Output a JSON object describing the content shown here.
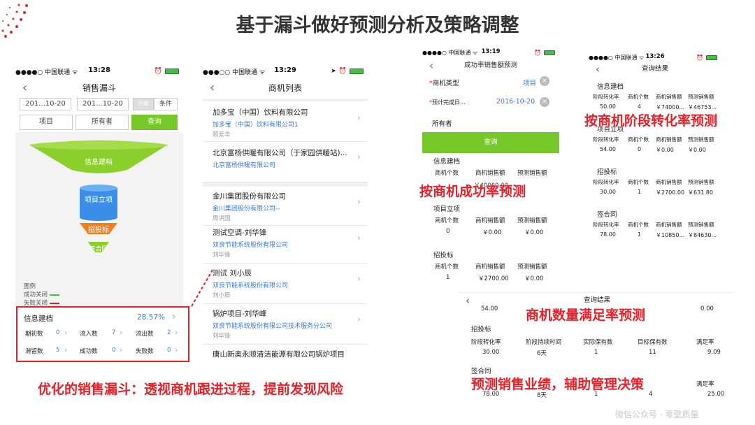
{
  "title": "基于漏斗做好预测分析及策略调整",
  "phone1": {
    "carrier": "●●●●○ 中国联通 ᯤ",
    "time": "13:28",
    "nav_title": "销售漏斗",
    "date_from": "201...10-20",
    "date_to": "201...10-20",
    "seg_plan": "方案",
    "seg_cond": "条件",
    "btn_project": "项目",
    "btn_owner": "所有者",
    "btn_query": "查询",
    "funnel": [
      "信息建档",
      "项目立项",
      "招投标",
      "签合同"
    ],
    "legend_title": "图例",
    "legend_won": "成功关闭",
    "legend_lost": "失败关闭",
    "summary_label": "信息建档",
    "summary_value": "28.57%",
    "stats": [
      {
        "label": "期初数",
        "value": "0"
      },
      {
        "label": "流入数",
        "value": "7"
      },
      {
        "label": "流出数",
        "value": "2"
      },
      {
        "label": "滞留数",
        "value": "5"
      },
      {
        "label": "成功数",
        "value": "0"
      },
      {
        "label": "失败数",
        "value": "0"
      }
    ]
  },
  "phone2": {
    "carrier": "●●●○○ 中国联通 ᯤ",
    "time": "13:29",
    "nav_title": "商机列表",
    "items": [
      {
        "title": "加多宝（中国）饮料有限公司",
        "sub": "加多宝（中国）饮料有限公司1",
        "person": "顾爱华"
      },
      {
        "title": "北京富杨供暖有限公司（于家园供暖站)...",
        "sub": "北京富杨供暖有限公司",
        "person": ""
      },
      {
        "title": "金川集团股份有限公司",
        "sub": "金川集团股份有限公司--",
        "person": "周洪国"
      },
      {
        "title": "测试空调-刘华锋",
        "sub": "双良节能系统股份有限公司",
        "person": "刘华锋"
      },
      {
        "title": "测试 刘小辰",
        "sub": "双良节能系统股份有限公司",
        "person": "刘小辰"
      },
      {
        "title": "锅炉项目-刘华峰",
        "sub": "双良节能系统股份有限公司技术服务分公司",
        "person": "刘华锋"
      },
      {
        "title": "唐山新奥永顺清洁能源有限公司锅炉项目",
        "sub": "",
        "person": ""
      }
    ]
  },
  "phone3": {
    "carrier": "●●●●○ 中国联通 ᯤ",
    "time": "13:19",
    "nav_title": "成功率销售额预测",
    "field1_label": "商机类型",
    "field1_value": "项目",
    "field2_label": "预计完成日...",
    "field2_value": "2016-10-20",
    "field3_label": "所有者",
    "btn_query": "查询",
    "col_count": "商机个数",
    "col_amount": "商机销售额",
    "col_forecast": "预测销售额",
    "sections": [
      {
        "name": "信息建档",
        "count": "",
        "amount": "￥40000.00",
        "forecast": ""
      },
      {
        "name": "项目立项",
        "count": "0",
        "amount": "￥0.00",
        "forecast": "￥0.00"
      },
      {
        "name": "招投标",
        "count": "1",
        "amount": "￥2700.00",
        "forecast": "￥0.00"
      }
    ]
  },
  "phone4": {
    "carrier": "●●●●○ 中国联通 ᯤ",
    "time": "13:26",
    "nav_title": "查询结果",
    "col_rate": "阶段转化率",
    "col_count": "商机个数",
    "col_amount": "商机销售额",
    "col_forecast": "预测销售额",
    "sections": [
      {
        "name": "信息建档",
        "rate": "50.00",
        "count": "4",
        "amount": "￥74000...",
        "forecast": "￥46753..."
      },
      {
        "name": "项目立项",
        "rate": "54.00",
        "count": "0",
        "amount": "￥0.00",
        "forecast": "￥0.00"
      },
      {
        "name": "招投标",
        "rate": "30.00",
        "count": "1",
        "amount": "￥2700.00",
        "forecast": "￥631.80"
      },
      {
        "name": "签合同",
        "rate": "78.00",
        "count": "1",
        "amount": "￥10850...",
        "forecast": "￥84630..."
      }
    ]
  },
  "phone5": {
    "nav_title": "查询结果",
    "top_left": "54.00",
    "top_right": "0.00",
    "sec1": "招投标",
    "sec2": "签合同",
    "cols": [
      "阶段转化率",
      "阶段持续时间",
      "实际保有数",
      "目标保有数",
      "满足率"
    ],
    "row1": [
      "30.00",
      "6天",
      "1",
      "11",
      "9.09"
    ],
    "row2": [
      "78.00",
      "8天",
      "1",
      "4",
      "25.00"
    ],
    "row2_last_header": "满足率"
  },
  "callouts": {
    "stage_rate": "按商机阶段转化率预测",
    "success_rate": "按商机成功率预测",
    "quantity": "商机数量满足率预测",
    "forecast": "预测销售业绩，辅助管理决策",
    "bottom": "优化的销售漏斗：透视商机跟进过程，提前发现风险"
  },
  "watermark": "微信公众号 · 零壁质量",
  "colors": {
    "accent_green": "#76c72a",
    "highlight_red": "#e8202a",
    "link_blue": "#3a7ad8"
  }
}
